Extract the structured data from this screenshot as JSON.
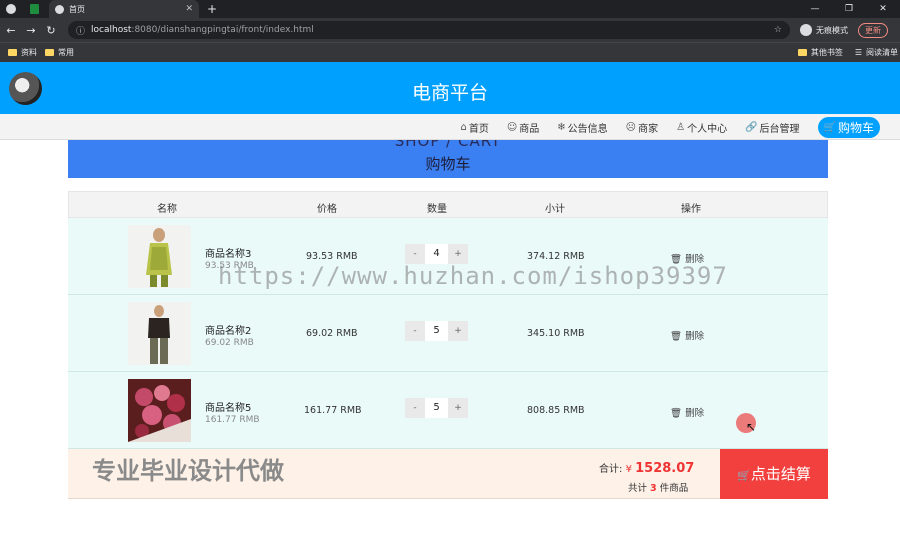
{
  "browser": {
    "tab_title": "首页",
    "url_host": "localhost",
    "url_path": ":8080/dianshangpingtai/front/index.html",
    "incognito_label": "无痕模式",
    "update_label": "更新",
    "bookmarks_left": [
      "资料",
      "常用"
    ],
    "bookmarks_right": [
      "其他书签",
      "阅读清单"
    ]
  },
  "site": {
    "title": "电商平台",
    "nav": [
      {
        "icon": "⌂",
        "label": "首页"
      },
      {
        "icon": "☺",
        "label": "商品"
      },
      {
        "icon": "❄",
        "label": "公告信息"
      },
      {
        "icon": "☹",
        "label": "商家"
      },
      {
        "icon": "♙",
        "label": "个人中心"
      },
      {
        "icon": "🔗",
        "label": "后台管理"
      },
      {
        "icon": "🛒",
        "label": "购物车"
      }
    ]
  },
  "banner": {
    "en": "SHOP / CART",
    "cn": "购物车"
  },
  "table": {
    "headers": [
      "名称",
      "价格",
      "数量",
      "小计",
      "操作"
    ],
    "rows": [
      {
        "name": "商品名称3",
        "sub": "93.53 RMB",
        "price": "93.53 RMB",
        "qty": "4",
        "subtotal": "374.12 RMB",
        "action": "删除"
      },
      {
        "name": "商品名称2",
        "sub": "69.02 RMB",
        "price": "69.02 RMB",
        "qty": "5",
        "subtotal": "345.10 RMB",
        "action": "删除"
      },
      {
        "name": "商品名称5",
        "sub": "161.77 RMB",
        "price": "161.77 RMB",
        "qty": "5",
        "subtotal": "808.85 RMB",
        "action": "删除"
      }
    ],
    "stepper_minus": "-",
    "stepper_plus": "+"
  },
  "summary": {
    "promo": "专业毕业设计代做",
    "total_label": "合计:",
    "currency": "¥",
    "total": "1528.07",
    "count_prefix": "共计",
    "count": "3",
    "count_suffix": "件商品",
    "checkout_label": "点击结算"
  },
  "watermark": "https://www.huzhan.com/ishop39397",
  "colors": {
    "primary": "#00a0ff",
    "banner": "#3b80f2",
    "checkout": "#f2403e",
    "accent_red": "#ee3333"
  }
}
